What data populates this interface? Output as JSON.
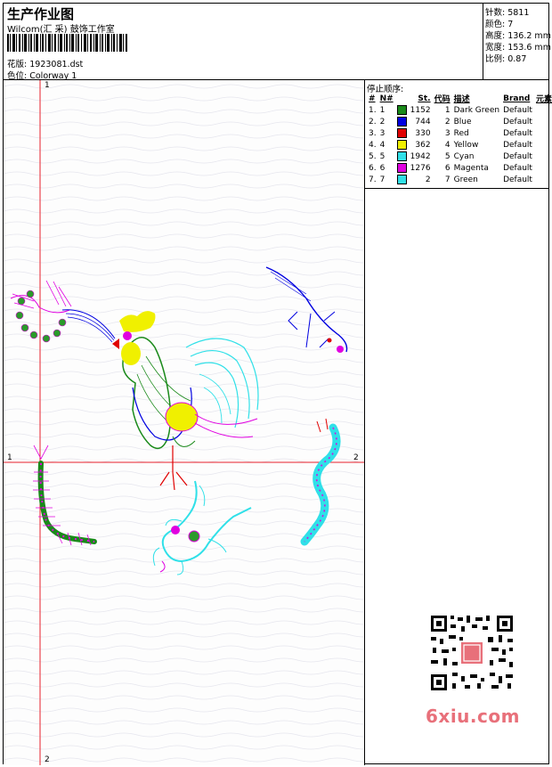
{
  "header": {
    "title": "生产作业图",
    "company": "Wilcom(汇 采) 鼓饰工作室",
    "design_label": "花版:",
    "design_value": "1923081.dst",
    "colorway_label": "色位:",
    "colorway_value": "Colorway 1"
  },
  "stats": {
    "stitches": "针数: 5811",
    "colors": "颜色: 7",
    "height": "高度: 136.2 mm",
    "width": "宽度: 153.6 mm",
    "scale": "比例: 0.87"
  },
  "stop_sequence": {
    "title": "停止顺序:",
    "headers": [
      "#",
      "N#",
      "St.",
      "代码",
      "描述",
      "Brand",
      "元素"
    ],
    "rows": [
      {
        "num": "1.",
        "n": "1",
        "color": "#1a8a1a",
        "st": "1152",
        "code": "1",
        "desc": "Dark Green",
        "brand": "Default"
      },
      {
        "num": "2.",
        "n": "2",
        "color": "#0000e0",
        "st": "744",
        "code": "2",
        "desc": "Blue",
        "brand": "Default"
      },
      {
        "num": "3.",
        "n": "3",
        "color": "#e00000",
        "st": "330",
        "code": "3",
        "desc": "Red",
        "brand": "Default"
      },
      {
        "num": "4.",
        "n": "4",
        "color": "#f0f000",
        "st": "362",
        "code": "4",
        "desc": "Yellow",
        "brand": "Default"
      },
      {
        "num": "5.",
        "n": "5",
        "color": "#30e0e8",
        "st": "1942",
        "code": "5",
        "desc": "Cyan",
        "brand": "Default"
      },
      {
        "num": "6.",
        "n": "6",
        "color": "#e000e0",
        "st": "1276",
        "code": "6",
        "desc": "Magenta",
        "brand": "Default"
      },
      {
        "num": "7.",
        "n": "7",
        "color": "#30e0e8",
        "st": "2",
        "code": "7",
        "desc": "Green",
        "brand": "Default"
      }
    ]
  },
  "axes": {
    "h_left": "1",
    "h_right": "2",
    "v_top": "1",
    "v_bottom": "2"
  },
  "watermark": {
    "text": "6xiu.com"
  },
  "colors": {
    "axis": "#e8202a",
    "brand": "#e8707a"
  }
}
